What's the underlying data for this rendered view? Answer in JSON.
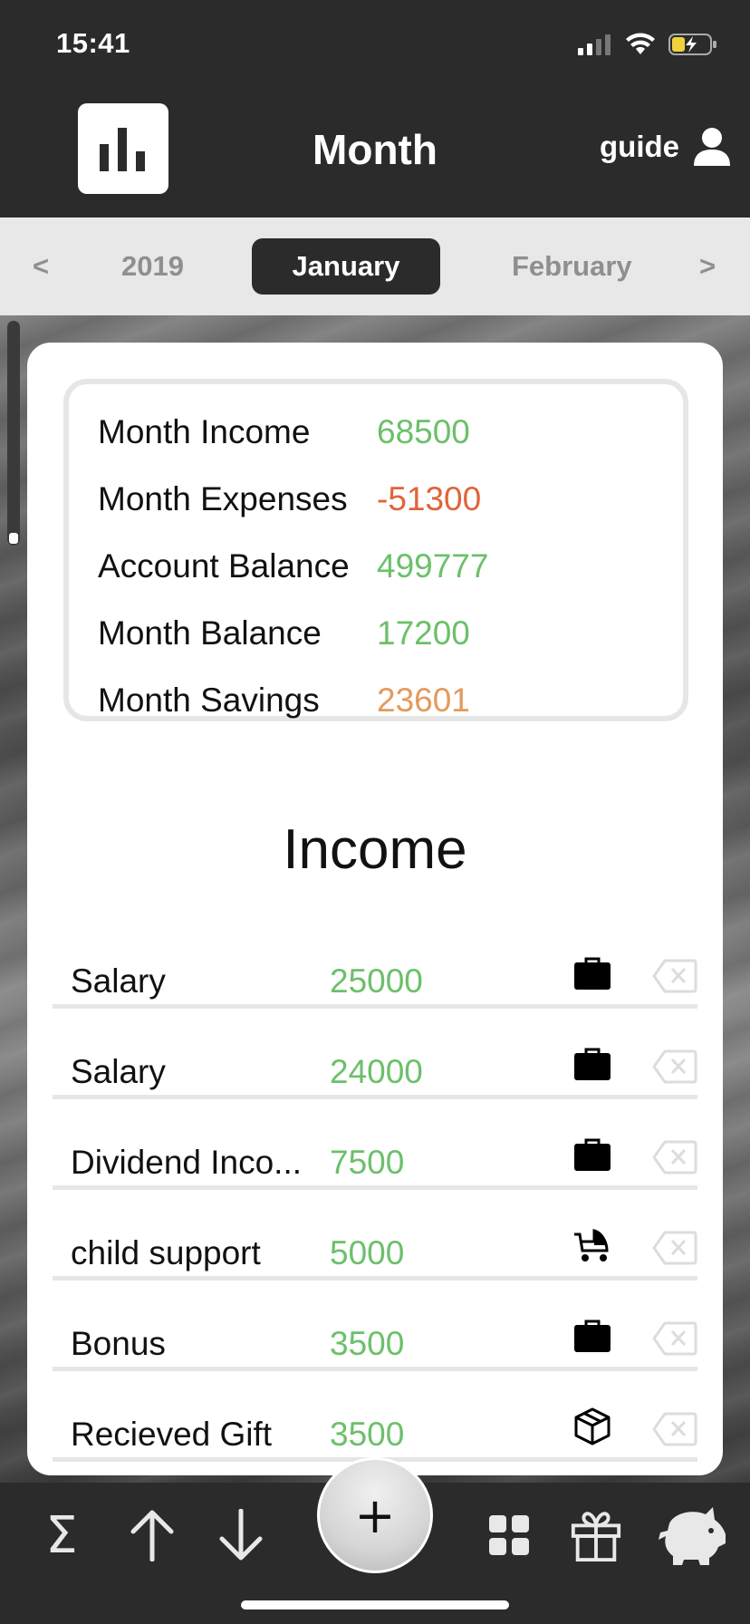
{
  "status_bar": {
    "time": "15:41"
  },
  "header": {
    "title": "Month",
    "guide_label": "guide",
    "logo_icon": "bar-chart-icon",
    "user_icon": "user-icon"
  },
  "month_selector": {
    "prev": "<",
    "year": "2019",
    "current": "January",
    "next_month": "February",
    "next": ">"
  },
  "summary": {
    "rows": [
      {
        "label": "Month Income",
        "value": "68500",
        "color": "#6cc06a"
      },
      {
        "label": "Month Expenses",
        "value": "-51300",
        "color": "#e0643a"
      },
      {
        "label": "Account Balance",
        "value": "499777",
        "color": "#6cc06a"
      },
      {
        "label": "Month Balance",
        "value": "17200",
        "color": "#6cc06a"
      },
      {
        "label": "Month Savings",
        "value": "23601",
        "color": "#e39a5c"
      }
    ]
  },
  "income": {
    "title": "Income",
    "items": [
      {
        "label": "Salary",
        "value": "25000",
        "icon": "briefcase-icon"
      },
      {
        "label": "Salary",
        "value": "24000",
        "icon": "briefcase-icon"
      },
      {
        "label": "Dividend Inco...",
        "value": "7500",
        "icon": "briefcase-icon"
      },
      {
        "label": "child support",
        "value": "5000",
        "icon": "stroller-icon"
      },
      {
        "label": "Bonus",
        "value": "3500",
        "icon": "briefcase-icon"
      },
      {
        "label": "Recieved Gift",
        "value": "3500",
        "icon": "box-icon"
      }
    ]
  },
  "tab_bar": {
    "sigma": "Σ",
    "add": "+",
    "items": [
      "sum-icon",
      "arrow-up-icon",
      "arrow-down-icon",
      "add-icon",
      "grid-icon",
      "gift-icon",
      "piggy-bank-icon"
    ]
  }
}
